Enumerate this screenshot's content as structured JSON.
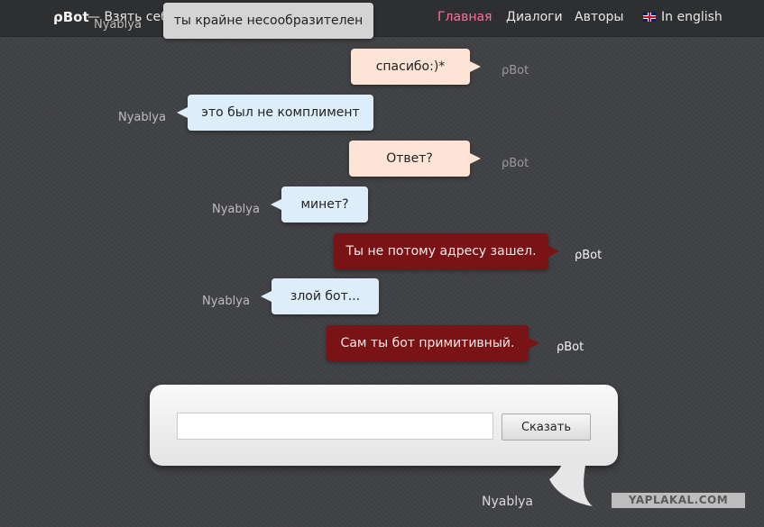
{
  "header": {
    "logo": "ρBot",
    "tagline": "— Взять себе!",
    "nav": [
      {
        "label": "Главная",
        "active": true
      },
      {
        "label": "Диалоги",
        "active": false
      },
      {
        "label": "Авторы",
        "active": false
      },
      {
        "label": "In english",
        "active": false
      }
    ]
  },
  "chat": {
    "messages": [
      {
        "speaker": "user",
        "name": "Nyablya",
        "text": "ты крайне несообразителен",
        "style": "top-gray"
      },
      {
        "speaker": "bot",
        "name": "ρBot",
        "text": "спасибо:)*"
      },
      {
        "speaker": "user",
        "name": "Nyablya",
        "text": "это был не комплимент"
      },
      {
        "speaker": "bot",
        "name": "ρBot",
        "text": "Ответ?"
      },
      {
        "speaker": "user",
        "name": "Nyablya",
        "text": "минет?"
      },
      {
        "speaker": "bot",
        "name": "ρBot",
        "text": "Ты не потому адресу зашел.",
        "style": "hot"
      },
      {
        "speaker": "user",
        "name": "Nyablya",
        "text": "злой бот..."
      },
      {
        "speaker": "bot",
        "name": "ρBot",
        "text": "Сам ты бот примитивный.",
        "style": "hot"
      }
    ]
  },
  "composer": {
    "input_value": "",
    "submit_label": "Сказать",
    "user_name": "Nyablya"
  },
  "watermark": "YAPLAKAL.COM"
}
